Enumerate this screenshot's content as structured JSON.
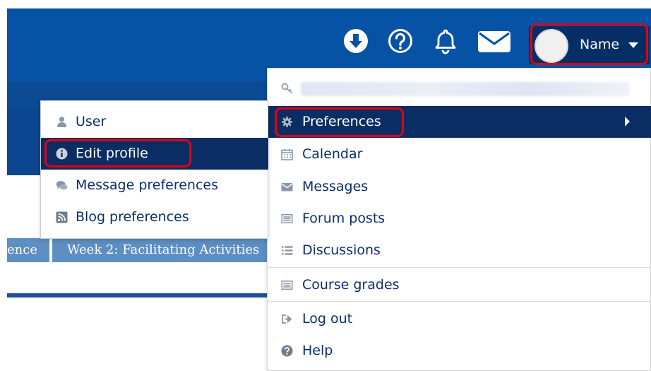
{
  "header": {
    "user_name": "Name",
    "icons": [
      "download-circle-icon",
      "help-circle-icon",
      "bell-icon",
      "envelope-icon"
    ]
  },
  "tabs": [
    {
      "label": "ence"
    },
    {
      "label": "Week 2: Facilitating Activities"
    }
  ],
  "user_menu": {
    "items": [
      {
        "label": "Preferences",
        "icon": "gear-icon",
        "active": true
      },
      {
        "label": "Calendar",
        "icon": "calendar-icon"
      },
      {
        "label": "Messages",
        "icon": "envelope-icon"
      },
      {
        "label": "Forum posts",
        "icon": "list-alt-icon"
      },
      {
        "label": "Discussions",
        "icon": "list-icon"
      },
      {
        "label": "Course grades",
        "icon": "list-alt-icon"
      },
      {
        "label": "Log out",
        "icon": "sign-out-icon"
      },
      {
        "label": "Help",
        "icon": "question-circle-icon"
      }
    ]
  },
  "preferences_submenu": {
    "items": [
      {
        "label": "User",
        "icon": "user-icon"
      },
      {
        "label": "Edit profile",
        "icon": "info-circle-icon",
        "active": true
      },
      {
        "label": "Message preferences",
        "icon": "comments-icon"
      },
      {
        "label": "Blog preferences",
        "icon": "rss-square-icon"
      }
    ]
  },
  "colors": {
    "navbar": "#0653a6",
    "active_item": "#0a2d63",
    "link_text": "#0b2f6b",
    "highlight": "#e3000f",
    "tab": "#5d8ec4"
  }
}
